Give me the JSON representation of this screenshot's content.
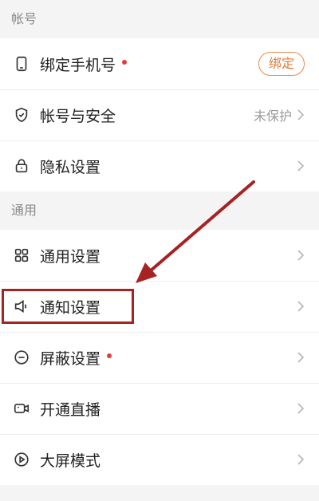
{
  "sections": {
    "account": {
      "title": "帐号",
      "items": [
        {
          "label": "绑定手机号",
          "dot": true,
          "button": "绑定"
        },
        {
          "label": "帐号与安全",
          "value": "未保护"
        },
        {
          "label": "隐私设置"
        }
      ]
    },
    "general": {
      "title": "通用",
      "items": [
        {
          "label": "通用设置"
        },
        {
          "label": "通知设置"
        },
        {
          "label": "屏蔽设置",
          "dot": true
        },
        {
          "label": "开通直播"
        },
        {
          "label": "大屏模式"
        }
      ]
    }
  },
  "colors": {
    "accent": "#e07a38",
    "dot": "#e23b3b",
    "annotation": "#a52323"
  },
  "icons": [
    "phone-icon",
    "shield-check-icon",
    "lock-icon",
    "grid-icon",
    "speaker-icon",
    "minus-circle-icon",
    "video-camera-icon",
    "play-circle-icon"
  ]
}
